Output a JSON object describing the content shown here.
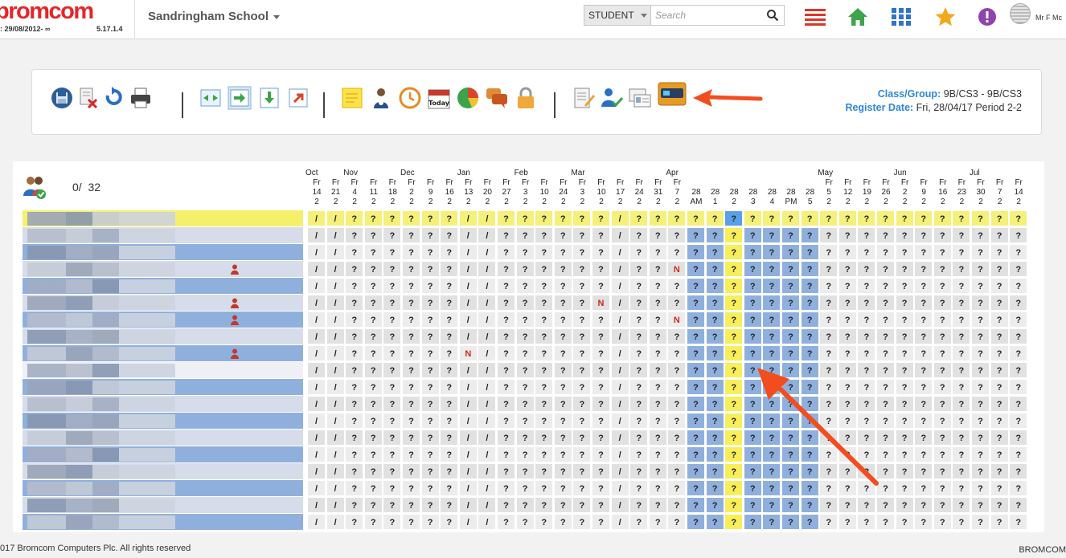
{
  "header": {
    "logo_text": "bromcom",
    "date_range": ": 29/08/2012- ∞",
    "version": "5.17.1.4",
    "school_name": "Sandringham School",
    "search_type": "STUDENT",
    "search_placeholder": "Search",
    "user_name": "Mr F Mc"
  },
  "toolbar": {
    "class_group_label": "Class/Group:",
    "class_group_value": "9B/CS3 - 9B/CS3",
    "register_date_label": "Register Date:",
    "register_date_value": "Fri, 28/04/17 Period 2-2",
    "today_label": "Today"
  },
  "register": {
    "count_current": "0",
    "count_total": "32"
  },
  "months": [
    {
      "label": "Oct",
      "col": 0
    },
    {
      "label": "Nov",
      "col": 2
    },
    {
      "label": "Dec",
      "col": 5
    },
    {
      "label": "Jan",
      "col": 8
    },
    {
      "label": "Feb",
      "col": 11
    },
    {
      "label": "Mar",
      "col": 14
    },
    {
      "label": "Apr",
      "col": 19
    },
    {
      "label": "May",
      "col": 27
    },
    {
      "label": "Jun",
      "col": 31
    },
    {
      "label": "Jul",
      "col": 35
    }
  ],
  "columns": [
    {
      "d": "Fr",
      "n": "14",
      "p": "2"
    },
    {
      "d": "Fr",
      "n": "21",
      "p": "2"
    },
    {
      "d": "Fr",
      "n": "4",
      "p": "2"
    },
    {
      "d": "Fr",
      "n": "11",
      "p": "2"
    },
    {
      "d": "Fr",
      "n": "18",
      "p": "2"
    },
    {
      "d": "Fr",
      "n": "2",
      "p": "2"
    },
    {
      "d": "Fr",
      "n": "9",
      "p": "2"
    },
    {
      "d": "Fr",
      "n": "16",
      "p": "2"
    },
    {
      "d": "Fr",
      "n": "13",
      "p": "2"
    },
    {
      "d": "Fr",
      "n": "20",
      "p": "2"
    },
    {
      "d": "Fr",
      "n": "27",
      "p": "2"
    },
    {
      "d": "Fr",
      "n": "3",
      "p": "2"
    },
    {
      "d": "Fr",
      "n": "10",
      "p": "2"
    },
    {
      "d": "Fr",
      "n": "24",
      "p": "2"
    },
    {
      "d": "Fr",
      "n": "3",
      "p": "2"
    },
    {
      "d": "Fr",
      "n": "10",
      "p": "2"
    },
    {
      "d": "Fr",
      "n": "17",
      "p": "2"
    },
    {
      "d": "Fr",
      "n": "24",
      "p": "2"
    },
    {
      "d": "Fr",
      "n": "31",
      "p": "2"
    },
    {
      "d": "Fr",
      "n": "7",
      "p": "2"
    },
    {
      "d": "",
      "n": "28",
      "p": "AM"
    },
    {
      "d": "",
      "n": "28",
      "p": "1"
    },
    {
      "d": "",
      "n": "28",
      "p": "2"
    },
    {
      "d": "",
      "n": "28",
      "p": "3"
    },
    {
      "d": "",
      "n": "28",
      "p": "4"
    },
    {
      "d": "",
      "n": "28",
      "p": "PM"
    },
    {
      "d": "",
      "n": "28",
      "p": "5"
    },
    {
      "d": "Fr",
      "n": "5",
      "p": "2"
    },
    {
      "d": "Fr",
      "n": "12",
      "p": "2"
    },
    {
      "d": "Fr",
      "n": "19",
      "p": "2"
    },
    {
      "d": "Fr",
      "n": "26",
      "p": "2"
    },
    {
      "d": "Fr",
      "n": "2",
      "p": "2"
    },
    {
      "d": "Fr",
      "n": "9",
      "p": "2"
    },
    {
      "d": "Fr",
      "n": "16",
      "p": "2"
    },
    {
      "d": "Fr",
      "n": "23",
      "p": "2"
    },
    {
      "d": "Fr",
      "n": "30",
      "p": "2"
    },
    {
      "d": "Fr",
      "n": "7",
      "p": "2"
    },
    {
      "d": "Fr",
      "n": "14",
      "p": "2"
    }
  ],
  "rows": [
    "//??????//??????/???????|???????????",
    "//??????//??????/???????|???????????",
    "//??????//??????/???????|???????????",
    "//??????//??????/??N????|???????????",
    "//??????//??????/???????|???????????",
    "//??????//?????N/???????|???????????",
    "//??????//??????/??N????|???????????",
    "//??????//??????/???????|???????????",
    "//??????N/??????/???????|???????????",
    "//??????//??????/???????|???????????",
    "//??????//??????/???????|???????????",
    "//??????//??????/???????|???????????",
    "//??????//??????/???????|???????????",
    "//??????//??????/???????|???????????",
    "//??????//??????/???????|???????????",
    "//??????//??????/???????|???????????",
    "//??????//??????/???????|???????????",
    "//??????//??????/???????|???????????",
    "//??????//??????/???????|???????????"
  ],
  "flag_rows": [
    3,
    5,
    6,
    8
  ],
  "footer": {
    "copyright": "017 Bromcom Computers Plc. All rights reserved",
    "brand": "BROMCOM"
  }
}
